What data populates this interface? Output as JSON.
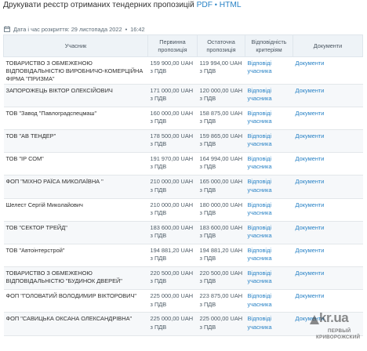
{
  "header": {
    "title": "Друкувати реєстр отриманих тендерних пропозицій",
    "pdf_link": "PDF",
    "separator": "•",
    "html_link": "HTML"
  },
  "meta": {
    "date_text": "Дата і час розкриття: 29 листопада 2022",
    "separator": "•",
    "time": "16:42"
  },
  "table": {
    "columns": [
      "Учасник",
      "Первинна пропозиція",
      "Остаточна пропозиція",
      "Відповідність критеріям",
      "Документи"
    ],
    "rows": [
      {
        "participant": "ТОВАРИСТВО З ОБМЕЖЕНОЮ ВІДПОВІДАЛЬНІСТЮ ВИРОБНИЧО-КОМЕРЦІЙНА ФІРМА \"ПРИЗМА\"",
        "initial": "159 900,00 UAH з ПДВ",
        "final": "119 994,00 UAH з ПДВ",
        "compliance": "Відповіді учасника",
        "docs": "Документи"
      },
      {
        "participant": "ЗАПОРОЖЕЦЬ ВІКТОР ОЛЕКСІЙОВИЧ",
        "initial": "171 000,00 UAH з ПДВ",
        "final": "120 000,00 UAH з ПДВ",
        "compliance": "Відповіді учасника",
        "docs": "Документи"
      },
      {
        "participant": "ТОВ \"Завод \"Павлоградспецмаш\"",
        "initial": "160 000,00 UAH з ПДВ",
        "final": "158 875,00 UAH з ПДВ",
        "compliance": "Відповіді учасника",
        "docs": "Документи"
      },
      {
        "participant": "ТОВ \"АВ ТЕНДЕР\"",
        "initial": "178 500,00 UAH з ПДВ",
        "final": "159 865,00 UAH з ПДВ",
        "compliance": "Відповіді учасника",
        "docs": "Документи"
      },
      {
        "participant": "ТОВ \"ІР СОМ\"",
        "initial": "191 970,00 UAH з ПДВ",
        "final": "164 994,00 UAH з ПДВ",
        "compliance": "Відповіді учасника",
        "docs": "Документи"
      },
      {
        "participant": "ФОП \"МІХНО РАЇСА МИКОЛАЇВНА \"",
        "initial": "210 000,00 UAH з ПДВ",
        "final": "165 000,00 UAH з ПДВ",
        "compliance": "Відповіді учасника",
        "docs": "Документи"
      },
      {
        "participant": "Шелест Сергій Миколайович",
        "initial": "210 000,00 UAH з ПДВ",
        "final": "180 000,00 UAH з ПДВ",
        "compliance": "Відповіді учасника",
        "docs": "Документи"
      },
      {
        "participant": "ТОВ \"СЕКТОР ТРЕЙД\"",
        "initial": "183 600,00 UAH з ПДВ",
        "final": "183 600,00 UAH з ПДВ",
        "compliance": "Відповіді учасника",
        "docs": "Документи"
      },
      {
        "participant": "ТОВ \"Автоінтерстрой\"",
        "initial": "194 881,20 UAH з ПДВ",
        "final": "194 881,20 UAH з ПДВ",
        "compliance": "Відповіді учасника",
        "docs": "Документи"
      },
      {
        "participant": "ТОВАРИСТВО З ОБМЕЖЕНОЮ ВІДПОВІДАЛЬНІСТЮ \"БУДИНОК ДВЕРЕЙ\"",
        "initial": "220 500,00 UAH з ПДВ",
        "final": "220 500,00 UAH з ПДВ",
        "compliance": "Відповіді учасника",
        "docs": "Документи"
      },
      {
        "participant": "ФОП \"ГОЛОВАТИЙ ВОЛОДИМИР ВІКТОРОВИЧ\"",
        "initial": "225 000,00 UAH з ПДВ",
        "final": "223 875,00 UAH з ПДВ",
        "compliance": "Відповіді учасника",
        "docs": "Документи"
      },
      {
        "participant": "ФОП \"САВИЦЬКА ОКСАНА ОЛЕКСАНДРІВНА\"",
        "initial": "225 000,00 UAH з ПДВ",
        "final": "225 000,00 UAH з ПДВ",
        "compliance": "Відповіді учасника",
        "docs": "Документи"
      }
    ]
  },
  "watermark": {
    "site": "kr.ua",
    "line1": "ПЕРВЫЙ",
    "line2": "КРИВОРОЖСКИЙ"
  },
  "colors": {
    "link": "#2a83c6",
    "header_bg": "#eef3f7",
    "stripe_bg": "#f6f8fa"
  }
}
